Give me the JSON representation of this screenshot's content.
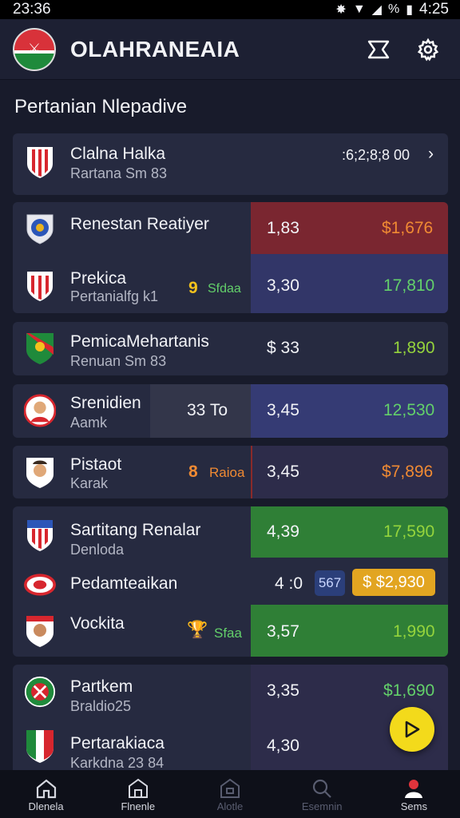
{
  "status": {
    "time": "23:36",
    "clock_right": "4:25",
    "battery": "%"
  },
  "app": {
    "title": "OLAHRANEAIA",
    "logo_mark": "⚔"
  },
  "section_title": "Pertanian Nlepadive",
  "featured": {
    "name": "Clalna Halka",
    "sub": "Rartana Sm 83",
    "value": ":6;2;8;8 00"
  },
  "matches": {
    "m1": {
      "name": "Renestan Reatiyer",
      "odd": "1,83",
      "amount": "$1,676"
    },
    "m2": {
      "name": "Prekica",
      "sub": "Pertanialfg k1",
      "tag_icon": "9",
      "tag": "Sfdaa",
      "odd": "3,30",
      "amount": "17,810"
    },
    "m3": {
      "name": "PemicaMehartanis",
      "sub": "Renuan Sm 83",
      "odd": "$ 33",
      "amount": "1,890"
    },
    "m4": {
      "name": "Srenidien",
      "sub": "Aamk",
      "live": "33 To",
      "odd": "3,45",
      "amount": "12,530"
    },
    "m5": {
      "name": "Pistaot",
      "sub": "Karak",
      "tag_icon": "8",
      "tag": "Raioa",
      "odd": "3,45",
      "amount": "$7,896"
    },
    "m6": {
      "name": "Sartitang Renalar",
      "sub": "Denloda",
      "odd": "4,39",
      "amount": "17,590"
    },
    "m7": {
      "name": "Pedamteaikan",
      "odd": "4 :0",
      "badge_blue": "567",
      "badge_gold": "$ $2,930"
    },
    "m8": {
      "name": "Vockita",
      "tag": "Sfaa",
      "odd": "3,57",
      "amount": "1,990"
    },
    "m9": {
      "name": "Partkem",
      "sub": "Braldio25",
      "odd": "3,35",
      "amount": "$1,690"
    },
    "m10": {
      "name": "Pertarakiaca",
      "sub": "Karkdna 23 84",
      "odd": "4,30"
    }
  },
  "nav": [
    {
      "label": "Dlenela",
      "icon": "home-icon"
    },
    {
      "label": "Flnenle",
      "icon": "house-icon"
    },
    {
      "label": "Alotle",
      "icon": "house-outline-icon"
    },
    {
      "label": "Esemnin",
      "icon": "search-icon"
    },
    {
      "label": "Sems",
      "icon": "profile-icon"
    }
  ],
  "colors": {
    "background": "#181b2b",
    "card": "#262a40",
    "odds_red": "#7a2630",
    "odds_blue": "#353b74",
    "odds_green": "#2f7f36",
    "accent_yellow": "#f3da1b"
  }
}
